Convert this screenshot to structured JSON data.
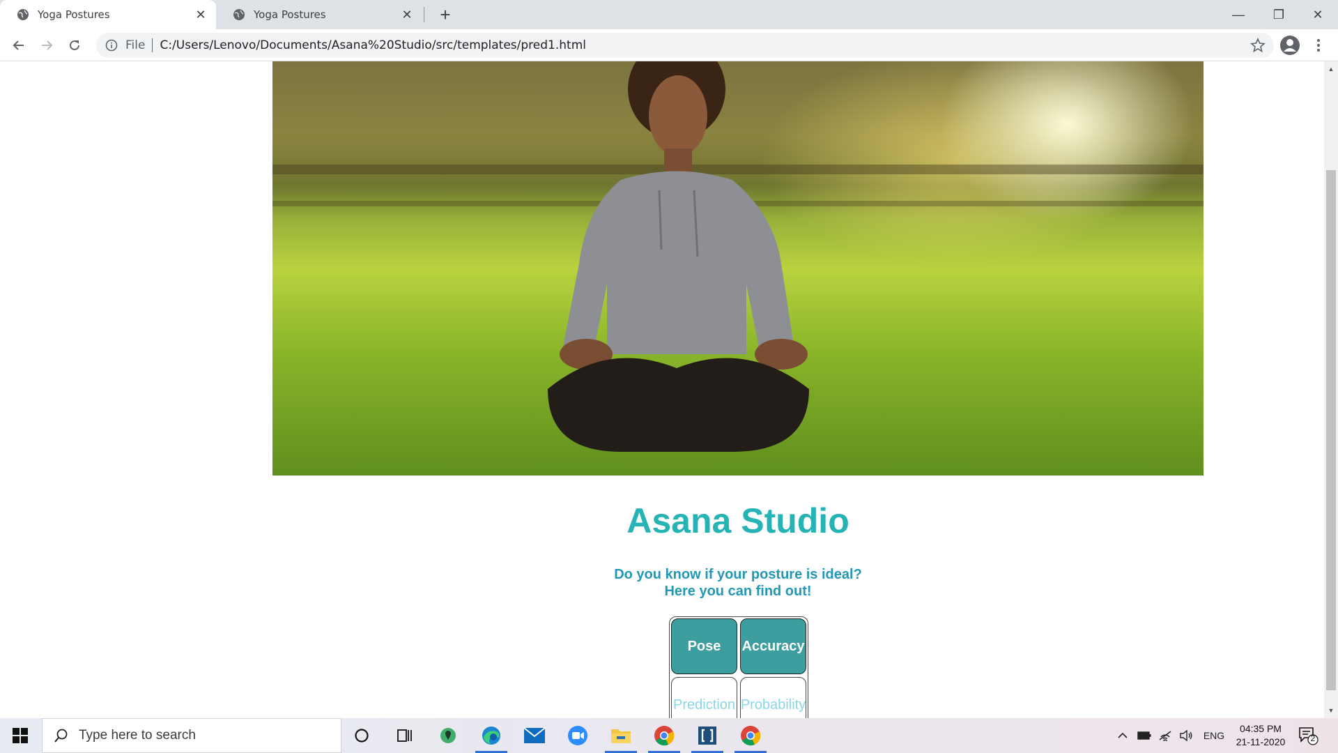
{
  "browser": {
    "tabs": [
      {
        "title": "Yoga Postures",
        "active": true
      },
      {
        "title": "Yoga Postures",
        "active": false
      }
    ],
    "new_tab_glyph": "+",
    "address": {
      "scheme": "File",
      "url": "C:/Users/Lenovo/Documents/Asana%20Studio/src/templates/pred1.html"
    },
    "window_controls": {
      "minimize": "—",
      "restore": "❐",
      "close": "✕"
    }
  },
  "page": {
    "title": "Asana Studio",
    "tagline_line1": "Do you know if your posture is ideal?",
    "tagline_line2": "Here you can find out!",
    "table": {
      "headers": [
        "Pose",
        "Accuracy"
      ],
      "row": [
        "Prediction",
        "Probability"
      ]
    },
    "colors": {
      "title": "#26b3b5",
      "tagline": "#2298b5",
      "header_bg": "#3d9ea0",
      "cell_text": "#8ad6e6"
    }
  },
  "taskbar": {
    "search_placeholder": "Type here to search",
    "language": "ENG",
    "time": "04:35 PM",
    "date": "21-11-2020",
    "notification_count": "2",
    "icons": [
      "cortana-icon",
      "task-view-icon",
      "maps-icon",
      "edge-icon",
      "mail-icon",
      "zoom-icon",
      "file-explorer-icon",
      "chrome-icon",
      "brackets-icon",
      "chrome-icon"
    ]
  }
}
